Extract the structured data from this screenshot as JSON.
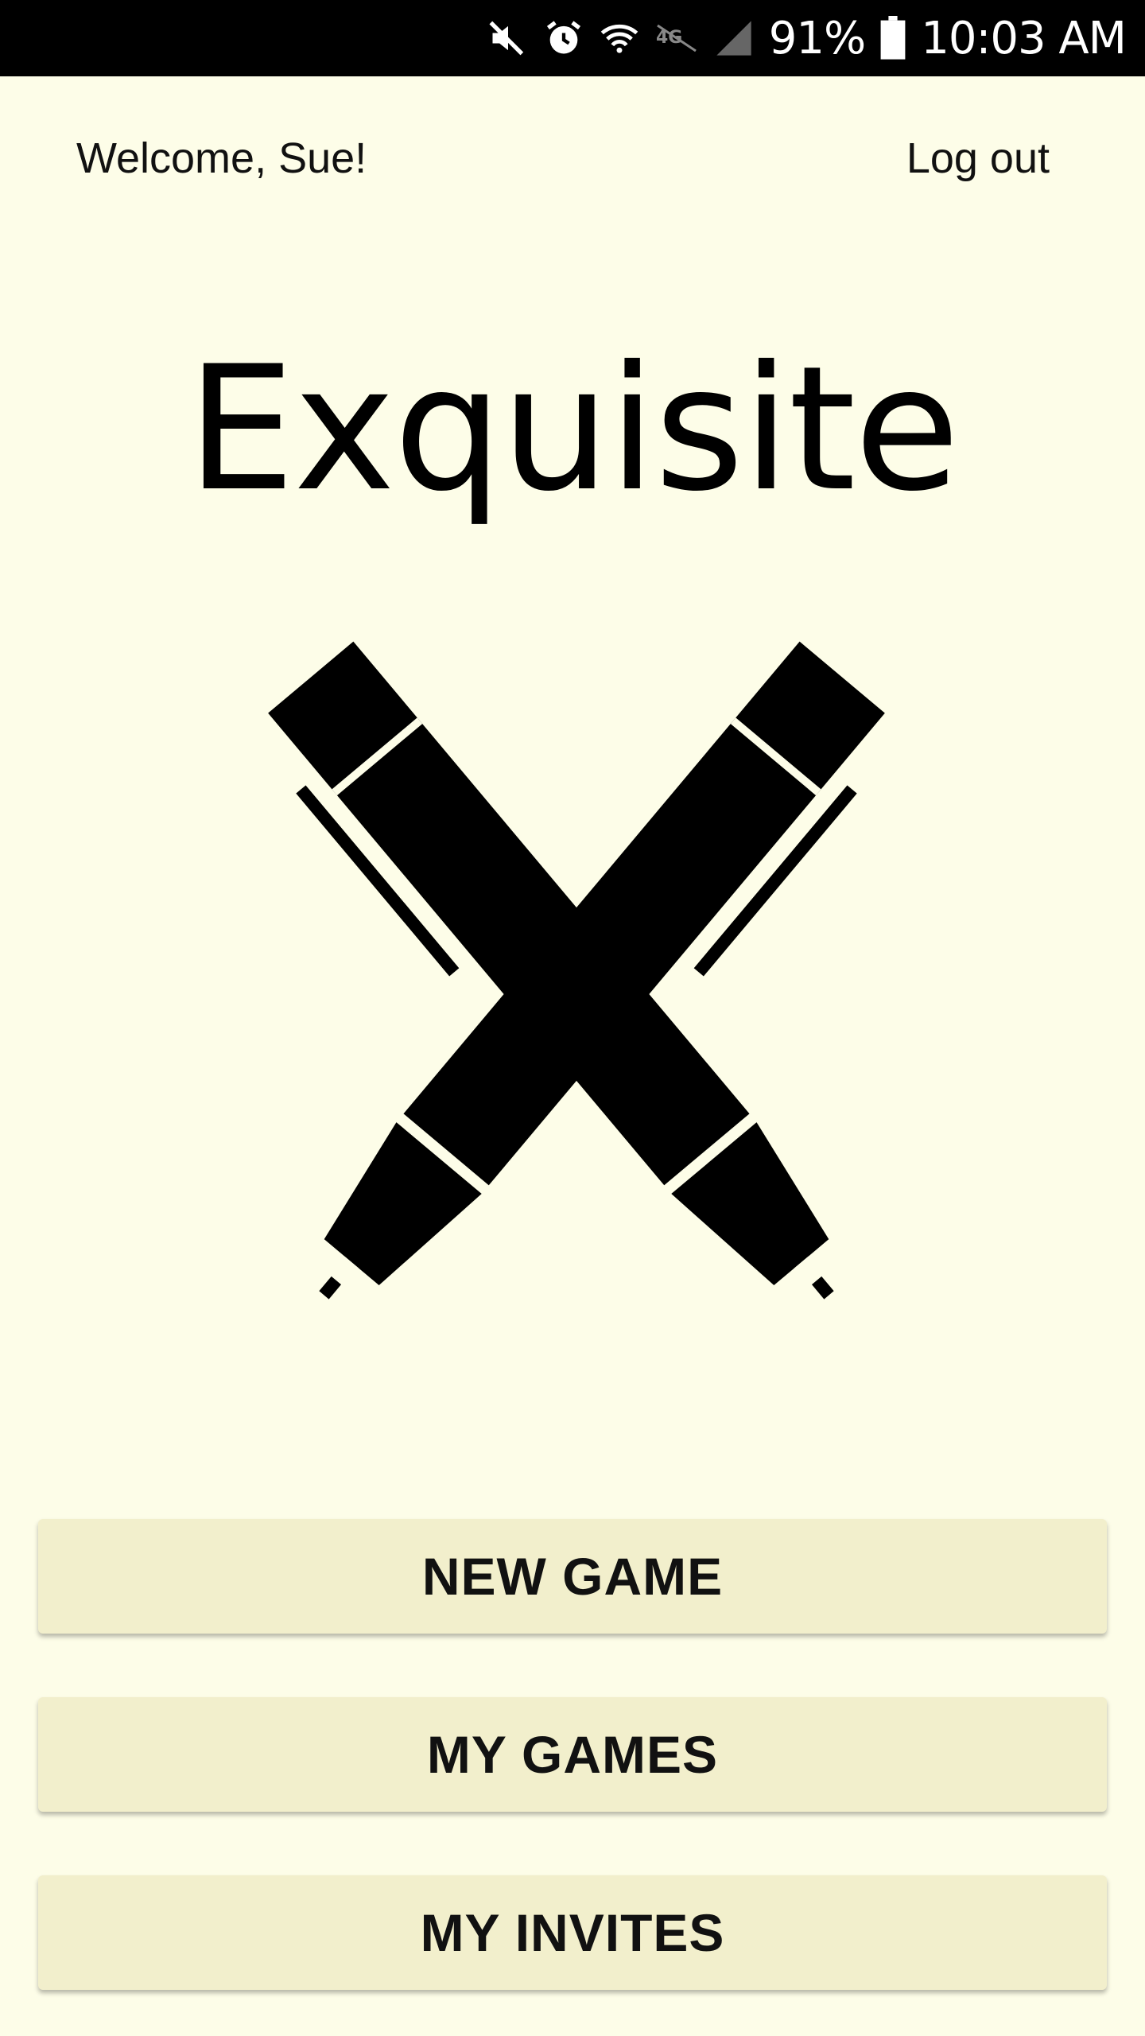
{
  "status_bar": {
    "battery_percent": "91%",
    "time": "10:03 AM",
    "icons": [
      "mute-icon",
      "alarm-icon",
      "wifi-icon",
      "lte-icon",
      "signal-icon",
      "battery-icon"
    ]
  },
  "header": {
    "welcome": "Welcome, Sue!",
    "logout": "Log out"
  },
  "app": {
    "title": "Exquisite",
    "logo_icon": "crossed-pens-icon"
  },
  "buttons": {
    "new_game": "NEW GAME",
    "my_games": "MY GAMES",
    "my_invites": "MY INVITES"
  },
  "colors": {
    "background": "#fdfde8",
    "button": "#f2efcc",
    "status_bar": "#000000"
  }
}
